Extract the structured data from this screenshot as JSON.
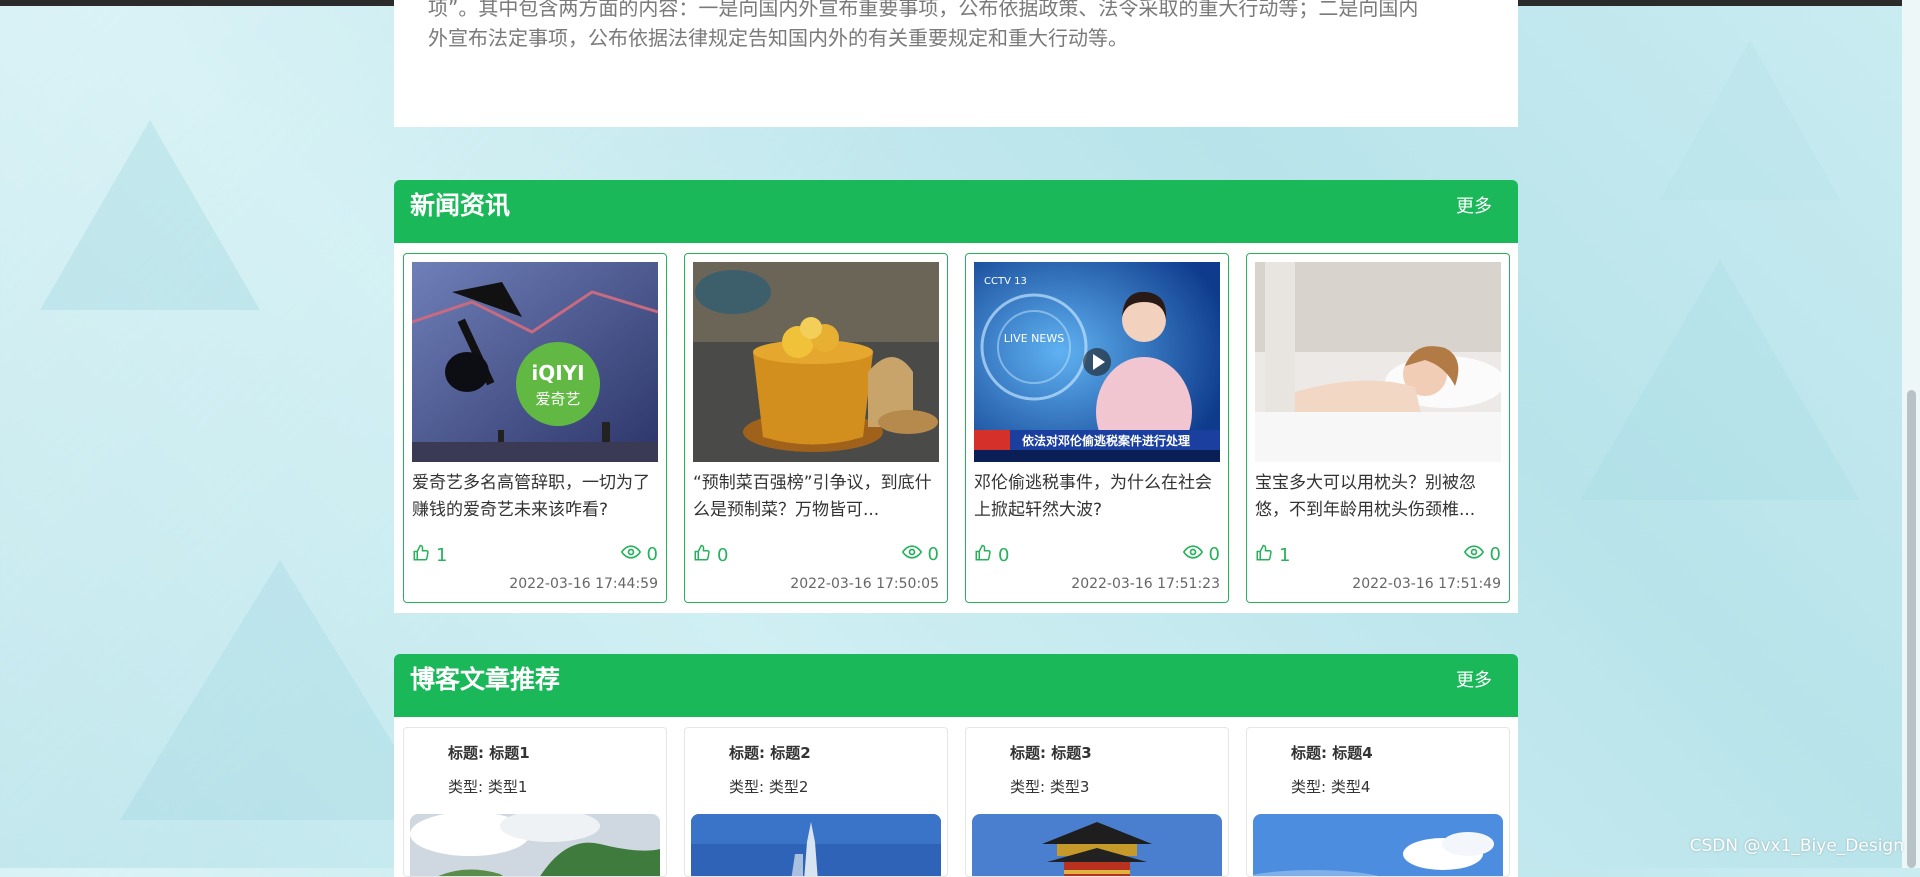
{
  "intro": {
    "text_line1": "项”。其中包含两方面的内容：一是向国内外宣布重要事项，公布依据政策、法令采取的重大行动等；二是向国内",
    "text_line2": "外宣布法定事项，公布依据法律规定告知国内外的有关重要规定和重大行动等。"
  },
  "news": {
    "title": "新闻资讯",
    "more": "更多",
    "items": [
      {
        "title": "爱奇艺多名高管辞职，一切为了赚钱的爱奇艺未来该咋看?",
        "likes": "1",
        "views": "0",
        "date": "2022-03-16 17:44:59",
        "logo_text": "iQIYI",
        "logo_sub": "爱奇艺"
      },
      {
        "title": "“预制菜百强榜”引争议，到底什么是预制菜？万物皆可...",
        "likes": "0",
        "views": "0",
        "date": "2022-03-16 17:50:05"
      },
      {
        "title": "邓伦偷逃税事件，为什么在社会上掀起轩然大波?",
        "likes": "0",
        "views": "0",
        "date": "2022-03-16 17:51:23",
        "tv_logo": "CCTV 13",
        "tv_caption": "依法对邓伦偷逃税案件进行处理",
        "tv_badge": "LIVE NEWS"
      },
      {
        "title": "宝宝多大可以用枕头？别被忽悠，不到年龄用枕头伤颈椎...",
        "likes": "1",
        "views": "0",
        "date": "2022-03-16 17:51:49"
      }
    ]
  },
  "blog": {
    "title": "博客文章推荐",
    "more": "更多",
    "items": [
      {
        "title_label": "标题: 标题1",
        "type_label": "类型: 类型1"
      },
      {
        "title_label": "标题: 标题2",
        "type_label": "类型: 类型2"
      },
      {
        "title_label": "标题: 标题3",
        "type_label": "类型: 类型3"
      },
      {
        "title_label": "标题: 标题4",
        "type_label": "类型: 类型4"
      }
    ]
  },
  "watermark": "CSDN @vx1_Biye_Design",
  "colors": {
    "accent": "#1bb85a",
    "card_border": "#27b15c"
  },
  "icons": {
    "like": "thumbs-up-icon",
    "view": "eye-icon"
  }
}
